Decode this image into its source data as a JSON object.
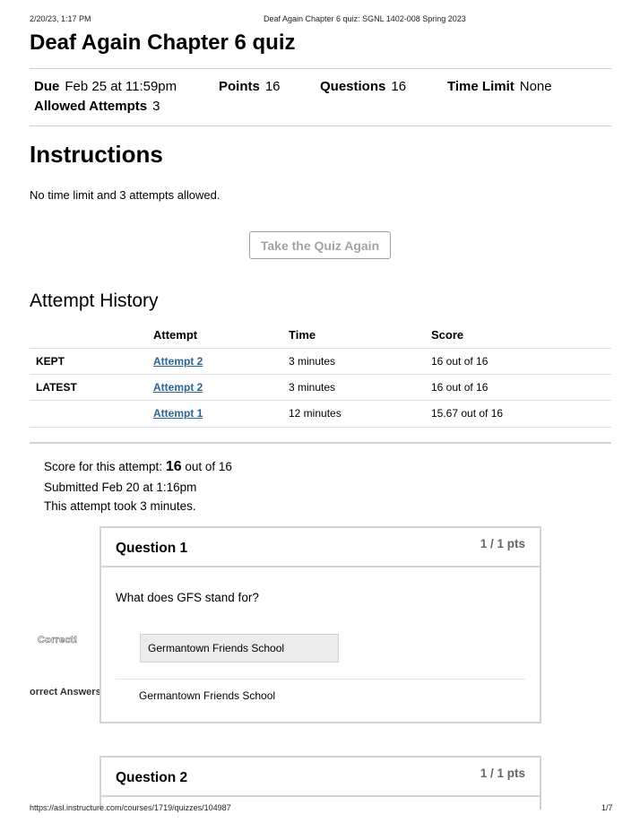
{
  "print": {
    "datetime": "2/20/23, 1:17 PM",
    "doc_title": "Deaf Again Chapter 6 quiz: SGNL 1402-008 Spring 2023",
    "url": "https://asl.instructure.com/courses/1719/quizzes/104987",
    "page": "1/7"
  },
  "quiz": {
    "title": "Deaf Again Chapter 6 quiz",
    "due_label": "Due",
    "due_value": "Feb 25 at 11:59pm",
    "points_label": "Points",
    "points_value": "16",
    "questions_label": "Questions",
    "questions_value": "16",
    "time_limit_label": "Time Limit",
    "time_limit_value": "None",
    "attempts_label": "Allowed Attempts",
    "attempts_value": "3"
  },
  "instructions": {
    "heading": "Instructions",
    "text": "No time limit and 3 attempts allowed."
  },
  "take_quiz_button": "Take the Quiz Again",
  "history": {
    "heading": "Attempt History",
    "columns": [
      "Attempt",
      "Time",
      "Score"
    ],
    "rows": [
      {
        "label": "KEPT",
        "attempt": "Attempt 2",
        "time": "3 minutes",
        "score": "16 out of 16"
      },
      {
        "label": "LATEST",
        "attempt": "Attempt 2",
        "time": "3 minutes",
        "score": "16 out of 16"
      },
      {
        "label": "",
        "attempt": "Attempt 1",
        "time": "12 minutes",
        "score": "15.67 out of 16"
      }
    ]
  },
  "summary": {
    "score_prefix": "Score for this attempt:",
    "score_value": "16",
    "score_suffix": "out of 16",
    "submitted": "Submitted Feb 20 at 1:16pm",
    "duration": "This attempt took 3 minutes."
  },
  "questions": [
    {
      "title": "Question 1",
      "points": "1 / 1 pts",
      "text": "What does GFS stand for?",
      "your_answer": "Germantown Friends School",
      "correct_answer": "Germantown Friends School"
    },
    {
      "title": "Question 2",
      "points": "1 / 1 pts"
    }
  ],
  "side_labels": {
    "correct": "Correct!",
    "correct_answers": "orrect Answers"
  }
}
